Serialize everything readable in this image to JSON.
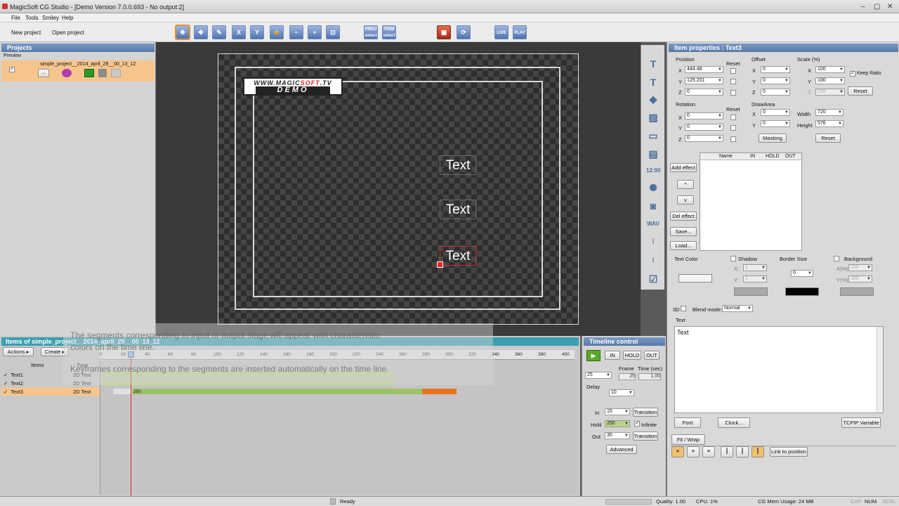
{
  "window": {
    "title": "MagicSoft CG Studio - [Demo Version 7.0.0.693 - No output:2]",
    "min": "–",
    "max": "▢",
    "close": "✕"
  },
  "menu": [
    "File",
    "Tools",
    "Smiley",
    "Help"
  ],
  "toolbar": {
    "new_project": "New project",
    "open_project": "Open project",
    "tools": [
      "✥",
      "✥",
      "✎",
      "X",
      "Y",
      "🔒",
      "−",
      "+",
      "⊡"
    ],
    "proj_select": "PROJ select",
    "item_select": "ITEM select",
    "live": "LIVE",
    "play": "PLAY"
  },
  "projects": {
    "header": "Projects",
    "preview_label": "Preview",
    "project_name": "simple_project__2014_april_29__00_13_12",
    "dots": "..."
  },
  "preview": {
    "logo_line1a": "WWW.MAGIC",
    "logo_line1b": "SOFT",
    "logo_line1c": ".TV",
    "logo_line2": "DEMO",
    "texts": [
      "Text",
      "Text",
      "Text"
    ]
  },
  "overlay": {
    "line1": "The segments corresponding to input or output stage will appear with characteristic",
    "line2": "colors on the time line.",
    "line3": "Keyframes corresponding to the segments are inserted  automatically on the time line."
  },
  "timeline": {
    "header": "Items of simple_project__2014_april_29__00_13_12",
    "actions": "Actions ▸",
    "create": "Create ▸",
    "col_items": "Items",
    "col_type": "Type",
    "ticks": [
      "0",
      "20",
      "40",
      "60",
      "80",
      "100",
      "120",
      "140",
      "160",
      "180",
      "200",
      "220",
      "240",
      "260",
      "280",
      "300",
      "320",
      "340",
      "360",
      "380",
      "400"
    ],
    "rows": [
      {
        "name": "Text1",
        "type": "2D Text"
      },
      {
        "name": "Text2",
        "type": "2D Text"
      },
      {
        "name": "Text3",
        "type": "2D Text",
        "marker": "250"
      }
    ]
  },
  "timeline_control": {
    "header": "Timeline control",
    "in": "IN",
    "hold": "HOLD",
    "out": "OUT",
    "fps": "25",
    "frame_label": "Frame",
    "time_label": "Time (sec)",
    "frame": "25",
    "time": "1.00",
    "delay_label": "Delay",
    "delay": "10",
    "in_label": "In",
    "in_value": "15",
    "hold_label": "Hold",
    "hold_value": "250",
    "infinite": "Infinite",
    "out_label": "Out",
    "out_value": "30",
    "transition": "Transition",
    "advanced": "Advanced"
  },
  "properties": {
    "header": "Item properties : Text3",
    "position": "Position",
    "reset": "Reset",
    "offset": "Offset",
    "scale": "Scale (%)",
    "x": "X",
    "y": "Y",
    "z": "Z",
    "pos_x": "444.48",
    "pos_y": "125.201",
    "pos_z": "0",
    "off_x": "0",
    "off_y": "0",
    "off_z": "0",
    "sc_x": "100",
    "sc_y": "100",
    "sc_z": "100",
    "keep_ratio": "Keep Ratio",
    "rotation": "Rotation",
    "rot_x": "0",
    "rot_y": "0",
    "rot_z": "0",
    "draw_area": "DrawArea",
    "da_x": "0",
    "da_y": "0",
    "width_label": "Width",
    "width": "720",
    "height_label": "Height",
    "height": "576",
    "masking": "Masking",
    "add_effect": "Add effect",
    "up": "^",
    "down": "v",
    "del_effect": "Del effect",
    "save": "Save...",
    "load": "Load...",
    "effect_cols": [
      "Name",
      "IN",
      "HOLD",
      "OUT"
    ],
    "text_color": "Text Color",
    "shadow": "Shadow",
    "border_size": "Border Size",
    "border_value": "0",
    "background": "Background",
    "sx": "X:",
    "sy": "Y:",
    "sval": "1",
    "bx": "X(%)",
    "by": "Y(%)",
    "bval": "100",
    "three_d": "3D",
    "blend_mode": "Blend mode:",
    "blend_value": "Normal",
    "text_section": "Text",
    "text_value": "Text",
    "font": "Font",
    "clock": "Clock...",
    "tcpip": "TCPIP Variable",
    "fit_wrap": "Fit / Wrap",
    "link_to_position": "Link to position"
  },
  "status": {
    "ready": "Ready",
    "quality": "Quality: 1.00",
    "cpu": "CPU: 1%",
    "mem": "CG Mem Usage: 24 MB",
    "cap": "CAP",
    "num": "NUM",
    "scrl": "SCRL"
  },
  "colors": {
    "accent": "#5779a8",
    "timeline_header": "#3a9fb0",
    "selected_row": "#f6c58c",
    "track_green": "#b8d48a",
    "out_segment": "#e8721c"
  }
}
